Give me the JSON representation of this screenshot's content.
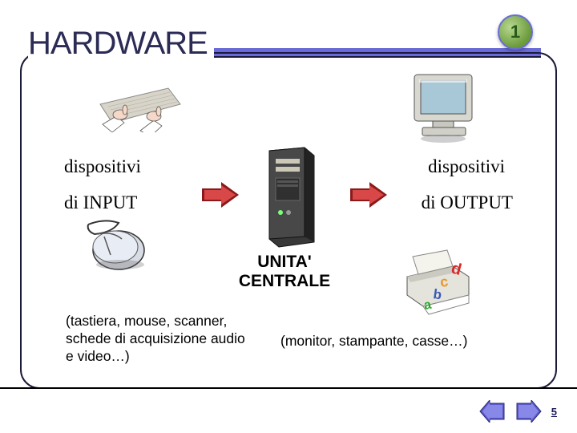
{
  "title": "HARDWARE",
  "badge": "1",
  "input": {
    "devices": "dispositivi",
    "type": "di INPUT"
  },
  "output": {
    "devices": "dispositivi",
    "type": "di OUTPUT"
  },
  "central_unit": "UNITA' CENTRALE",
  "examples_input": "(tastiera, mouse, scanner, schede di acquisizione audio e video…)",
  "examples_output": "(monitor, stampante, casse…)",
  "page_number": "5",
  "colors": {
    "accent": "#6a6ad8",
    "badge_fill": "#89b858",
    "arrow_dark": "#8a1a1a",
    "arrow_mid": "#c83a3a"
  }
}
